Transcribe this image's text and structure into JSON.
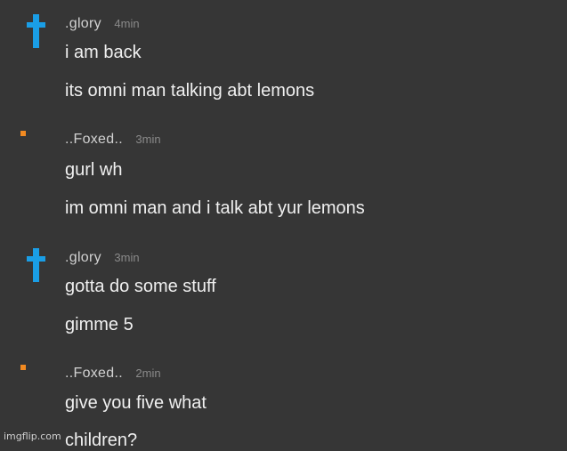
{
  "colors": {
    "background": "#363636",
    "cross_avatar": "#1a9ee6",
    "dot_avatar": "#f28a21"
  },
  "messages": [
    {
      "user": ".glory",
      "time": "4min",
      "avatar_icon": "cross-icon",
      "lines": [
        "i am back",
        "its omni man talking abt lemons"
      ]
    },
    {
      "user": "..Foxed..",
      "time": "3min",
      "avatar_icon": "orange-square-icon",
      "lines": [
        "gurl wh",
        "im omni man and i talk abt yur lemons"
      ]
    },
    {
      "user": ".glory",
      "time": "3min",
      "avatar_icon": "cross-icon",
      "lines": [
        "gotta do some stuff",
        "gimme 5"
      ]
    },
    {
      "user": "..Foxed..",
      "time": "2min",
      "avatar_icon": "orange-square-icon",
      "lines": [
        "give you five what",
        "children?"
      ]
    }
  ],
  "watermark": "imgflip.com"
}
